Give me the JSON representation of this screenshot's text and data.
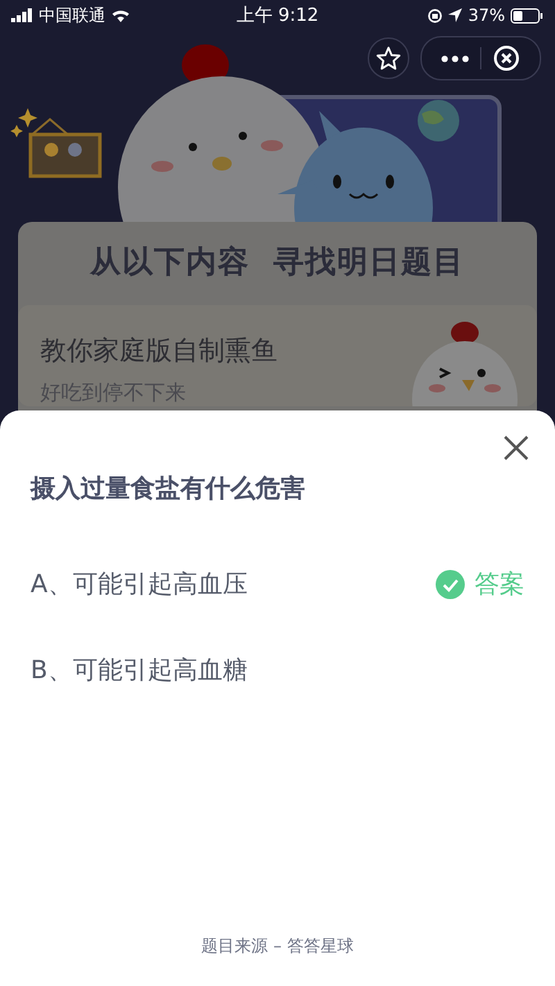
{
  "status_bar": {
    "carrier": "中国联通",
    "time": "上午 9:12",
    "battery": "37%"
  },
  "background": {
    "heading": "从以下内容  寻找明日题目",
    "article": {
      "title": "教你家庭版自制熏鱼",
      "subtitle": "好吃到停不下来"
    }
  },
  "sheet": {
    "question": "摄入过量食盐有什么危害",
    "answer_label": "答案",
    "options": [
      {
        "label": "A、可能引起高血压",
        "correct": true
      },
      {
        "label": "B、可能引起高血糖",
        "correct": false
      }
    ],
    "footer": "题目来源 – 答答星球"
  }
}
